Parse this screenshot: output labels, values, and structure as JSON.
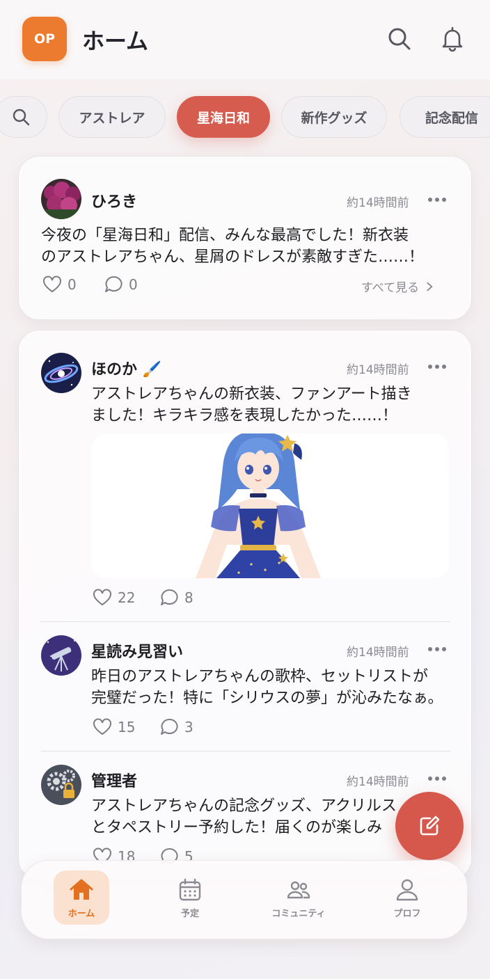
{
  "header": {
    "logo_text": "OP",
    "title": "ホーム",
    "icons": [
      "search-icon",
      "bell-icon"
    ]
  },
  "chips": [
    {
      "label": "",
      "icon": "search-icon"
    },
    {
      "label": "アストレア"
    },
    {
      "label": "星海日和",
      "active": true
    },
    {
      "label": "新作グッズ"
    },
    {
      "label": "記念配信"
    }
  ],
  "posts": [
    {
      "user": "ひろき",
      "time": "約14時間前",
      "text_lines": [
        "今夜の「星海日和」配信、みんな最高でした！新衣装",
        "のアストレアちゃん、星屑のドレスが素敵すぎた……！"
      ],
      "likes": "0",
      "comments": "0",
      "see_all": "すべて見る"
    },
    {
      "user": "ほのか 🖌️",
      "time": "約14時間前",
      "text_lines": [
        "アストレアちゃんの新衣装、ファンアート描き",
        "ました！キラキラ感を表現したかった……！"
      ],
      "likes": "22",
      "comments": "8"
    },
    {
      "user": "星読み見習い",
      "time": "約14時間前",
      "text_lines": [
        "昨日のアストレアちゃんの歌枠、セットリストが",
        "完璧だった！特に「シリウスの夢」が沁みたなぁ。"
      ],
      "likes": "15",
      "comments": "3"
    },
    {
      "user": "管理者",
      "time": "約14時間前",
      "text_lines": [
        "アストレアちゃんの記念グッズ、アクリルス",
        "とタペストリー予約した！届くのが楽しみ"
      ],
      "likes": "18",
      "comments": "5"
    }
  ],
  "nav": [
    {
      "label": "ホーム",
      "icon": "home-icon",
      "active": true
    },
    {
      "label": "予定",
      "icon": "calendar-icon"
    },
    {
      "label": "コミュニティ",
      "icon": "community-icon"
    },
    {
      "label": "プロフ",
      "icon": "profile-icon"
    }
  ],
  "colors": {
    "accent": "#d6584c",
    "brand": "#ec7a2f",
    "nav_active_bg": "#fbe1cf"
  }
}
